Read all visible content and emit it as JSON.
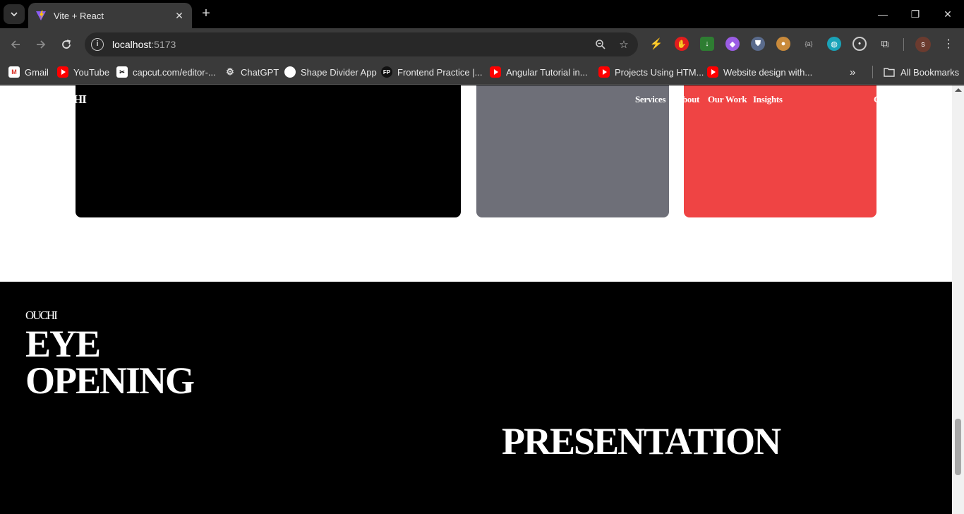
{
  "browser": {
    "tab_title": "Vite + React",
    "url_host": "localhost",
    "url_port": ":5173",
    "profile_initial": "s",
    "bookmarks": [
      {
        "label": "Gmail",
        "icon": "gmail-icon"
      },
      {
        "label": "YouTube",
        "icon": "youtube-icon"
      },
      {
        "label": "capcut.com/editor-...",
        "icon": "capcut-icon"
      },
      {
        "label": "ChatGPT",
        "icon": "chatgpt-icon"
      },
      {
        "label": "Shape Divider App",
        "icon": "shape-divider-icon"
      },
      {
        "label": "Frontend Practice |...",
        "icon": "fp-icon"
      },
      {
        "label": "Angular Tutorial in...",
        "icon": "youtube-icon"
      },
      {
        "label": "Projects Using HTM...",
        "icon": "youtube-icon"
      },
      {
        "label": "Website design with...",
        "icon": "youtube-icon"
      }
    ],
    "all_bookmarks_label": "All Bookmarks",
    "fp_badge": "FP"
  },
  "site": {
    "nav": {
      "logo_fragment": "HI",
      "links": [
        "Services",
        "bout",
        "Our Work",
        "Insights"
      ],
      "cta_fragment": "C"
    },
    "cards_colors": {
      "black": "#000000",
      "gray": "#6e6f78",
      "red": "#ef4444"
    },
    "hero": {
      "brand": "OUCHI",
      "headline_line1": "EYE",
      "headline_line2": "OPENING",
      "presentation": "PRESENTATION"
    }
  }
}
